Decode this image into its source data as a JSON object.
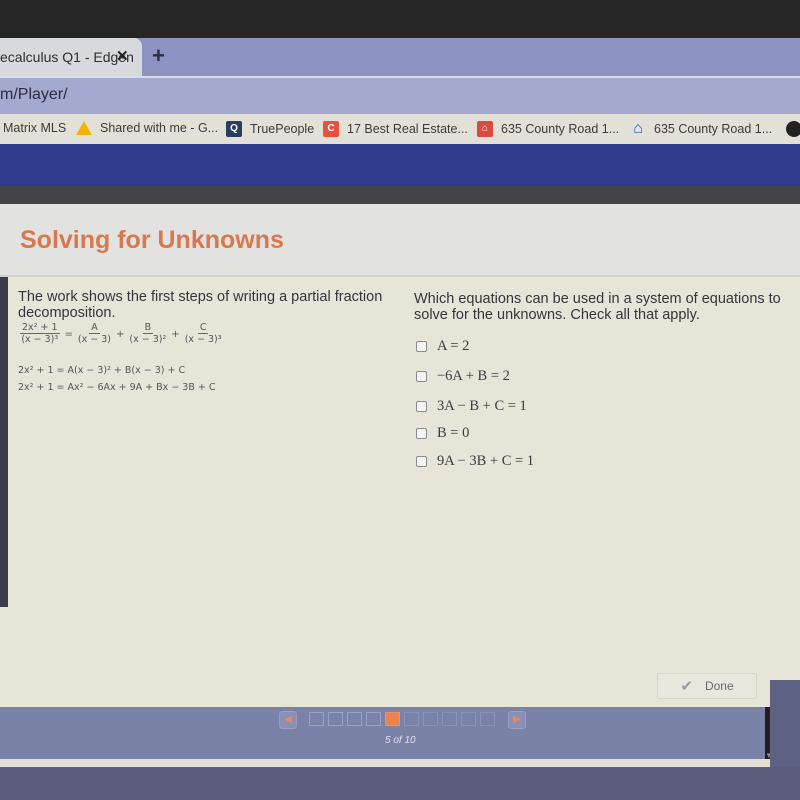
{
  "browser": {
    "tab": {
      "title": "ecalculus Q1 - Edgen",
      "close_icon": "close-icon"
    },
    "new_tab_label": "+",
    "url": "m/Player/",
    "bookmarks": [
      {
        "label": "Matrix MLS",
        "icon": "none"
      },
      {
        "label": "Shared with me - G...",
        "icon": "google-drive-icon"
      },
      {
        "label": "TruePeople",
        "icon": "search-icon"
      },
      {
        "label": "17 Best Real Estate...",
        "icon": "c-logo-icon"
      },
      {
        "label": "635 County Road 1...",
        "icon": "house-icon"
      },
      {
        "label": "635 County Road 1...",
        "icon": "zillow-icon"
      }
    ]
  },
  "lesson": {
    "title": "Solving for Unknowns"
  },
  "question_left": {
    "prompt": "The work shows the first steps of writing a partial fraction decomposition.",
    "fraction": {
      "lhs_num": "2x² + 1",
      "lhs_den": "(x − 3)³",
      "eq": "=",
      "terms": [
        {
          "num": "A",
          "den": "(x − 3)"
        },
        {
          "num": "B",
          "den": "(x − 3)²"
        },
        {
          "num": "C",
          "den": "(x − 3)³"
        }
      ],
      "plus": "+"
    },
    "step1": "2x² + 1 = A(x − 3)² + B(x − 3) + C",
    "step2": "2x² + 1 = Ax² − 6Ax + 9A + Bx − 3B + C"
  },
  "question_right": {
    "prompt": "Which equations can be used in a system of equations to solve for the unknowns. Check all that apply.",
    "options": [
      {
        "label": "A = 2",
        "checked": false
      },
      {
        "label": "−6A + B = 2",
        "checked": false
      },
      {
        "label": "3A − B + C = 1",
        "checked": false
      },
      {
        "label": "B = 0",
        "checked": false
      },
      {
        "label": "9A − 3B + C = 1",
        "checked": false
      }
    ]
  },
  "done_button": {
    "label": "Done",
    "icon": "check-icon"
  },
  "pager": {
    "current": 5,
    "total": 10,
    "count_text": "5 of 10",
    "prev_icon": "arrow-left-icon",
    "next_icon": "arrow-right-icon"
  },
  "colors": {
    "title_orange": "#d9784c",
    "nav_blue": "#2f3a8b",
    "current_page": "#e9824f"
  }
}
